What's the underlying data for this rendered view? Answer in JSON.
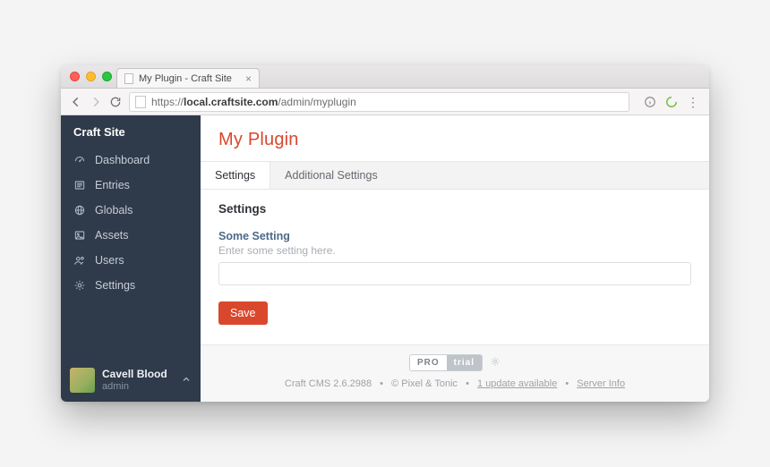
{
  "browser": {
    "tab_title": "My Plugin - Craft Site",
    "url_prefix": "https://",
    "url_host": "local.craftsite.com",
    "url_path": "/admin/myplugin"
  },
  "sidebar": {
    "brand": "Craft Site",
    "items": [
      {
        "label": "Dashboard",
        "icon": "gauge-icon"
      },
      {
        "label": "Entries",
        "icon": "list-icon"
      },
      {
        "label": "Globals",
        "icon": "globe-icon"
      },
      {
        "label": "Assets",
        "icon": "image-icon"
      },
      {
        "label": "Users",
        "icon": "users-icon"
      },
      {
        "label": "Settings",
        "icon": "gear-icon"
      }
    ],
    "user": {
      "name": "Cavell Blood",
      "role": "admin"
    }
  },
  "page": {
    "title": "My Plugin",
    "tabs": [
      {
        "label": "Settings",
        "active": true
      },
      {
        "label": "Additional Settings",
        "active": false
      }
    ],
    "section_title": "Settings",
    "field": {
      "label": "Some Setting",
      "help": "Enter some setting here.",
      "value": ""
    },
    "save_label": "Save"
  },
  "footer": {
    "pro": "PRO",
    "trial": "trial",
    "version": "Craft CMS 2.6.2988",
    "copyright": "© Pixel & Tonic",
    "update": "1 update available",
    "server_info": "Server Info"
  }
}
